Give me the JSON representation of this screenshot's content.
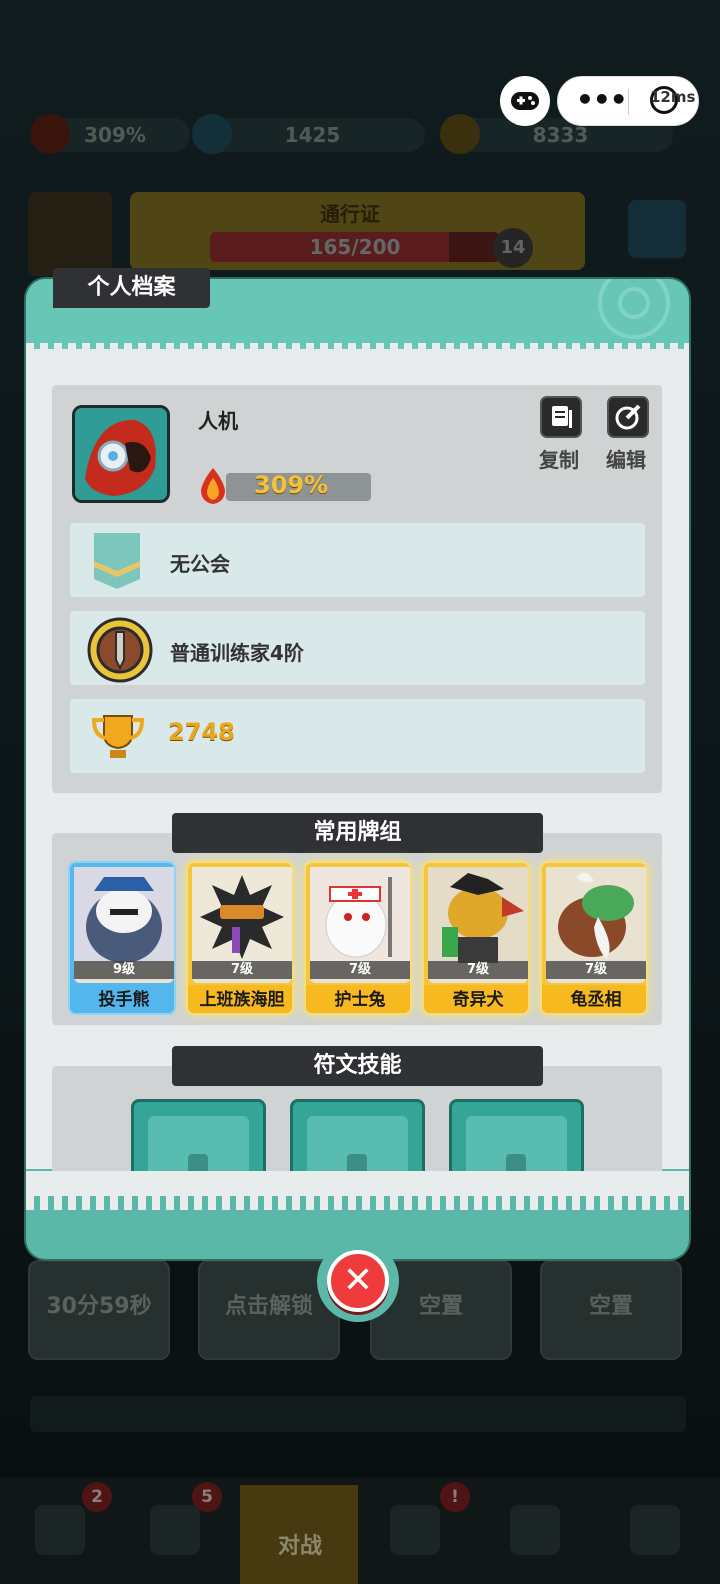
{
  "hud": {
    "rank_percent": "309%",
    "gems": "1425",
    "coins": "8333",
    "pass_title": "通行证",
    "pass_progress": "165/200",
    "pass_progress_value": 0.825,
    "pass_level": "14"
  },
  "capsule": {
    "latency": "12ms"
  },
  "modal": {
    "title": "个人档案",
    "player": {
      "name": "人机",
      "rank_percent": "309%",
      "copy_label": "复制",
      "edit_label": "编辑"
    },
    "guild": "无公会",
    "trainer_rank": "普通训练家4阶",
    "trophies": "2748",
    "deck_title": "常用牌组",
    "deck": [
      {
        "name": "投手熊",
        "level": "9级",
        "rarity": "blue"
      },
      {
        "name": "上班族海胆",
        "level": "7级",
        "rarity": "gold"
      },
      {
        "name": "护士兔",
        "level": "7级",
        "rarity": "gold"
      },
      {
        "name": "奇异犬",
        "level": "7级",
        "rarity": "gold"
      },
      {
        "name": "龟丞相",
        "level": "7级",
        "rarity": "gold"
      }
    ],
    "rune_title": "符文技能"
  },
  "bottom": {
    "chest1_timer": "30分59秒",
    "chest2_label": "点击解锁",
    "slot3": "空置",
    "slot4": "空置",
    "tab_battle": "对战",
    "badge_1": "2",
    "badge_2": "5",
    "badge_3": "!"
  },
  "colors": {
    "panel_teal": "#5bb8a8",
    "gold_card": "#f4c63b",
    "blue_card": "#55b9ee",
    "close_red": "#ef3b3b"
  }
}
